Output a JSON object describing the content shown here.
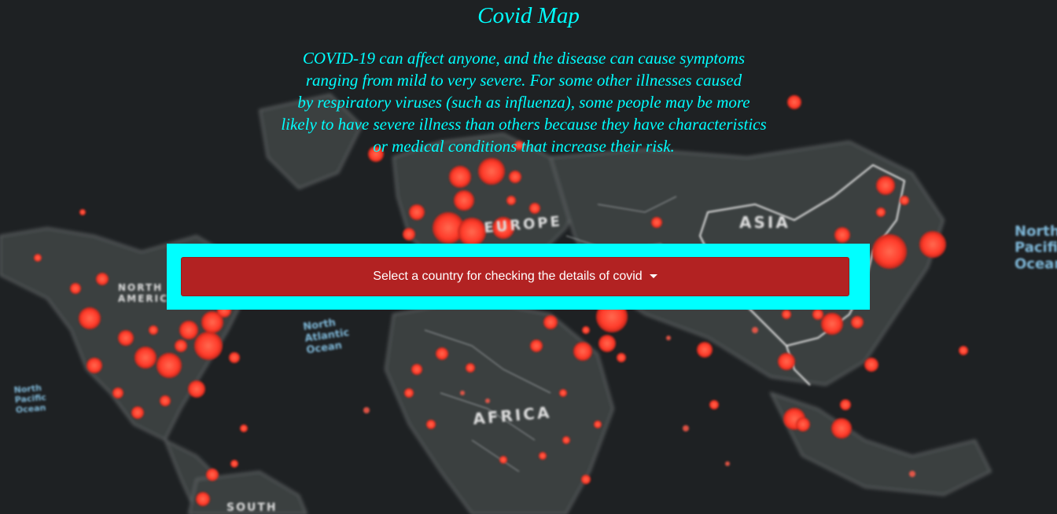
{
  "page": {
    "title": "Covid Map",
    "description_lines": [
      "COVID-19 can affect anyone, and the disease can cause symptoms",
      "ranging from mild to very severe. For some other illnesses caused",
      "by respiratory viruses (such as influenza), some people may be more",
      "likely to have severe illness than others because they have characteristics",
      "or medical conditions that increase their risk."
    ]
  },
  "selector": {
    "label": "Select a country for checking the details of covid",
    "icon": "caret-down-icon"
  },
  "map_labels": {
    "europe": "EUROPE",
    "asia": "ASIA",
    "africa": "AFRICA",
    "north_atlantic": "North Atlantic Ocean",
    "north_pacific_left": "North Pacific Ocean",
    "north_pacific_right": "North Pacific Ocean",
    "north_america": "NORTH AMERICA",
    "south": "SOUTH"
  },
  "colors": {
    "background": "#1f2224",
    "land": "#3a3e40",
    "hotspot": "#ff3b2a",
    "title_text": "#00ffff",
    "frame": "#00ffff",
    "button": "#b22222"
  }
}
